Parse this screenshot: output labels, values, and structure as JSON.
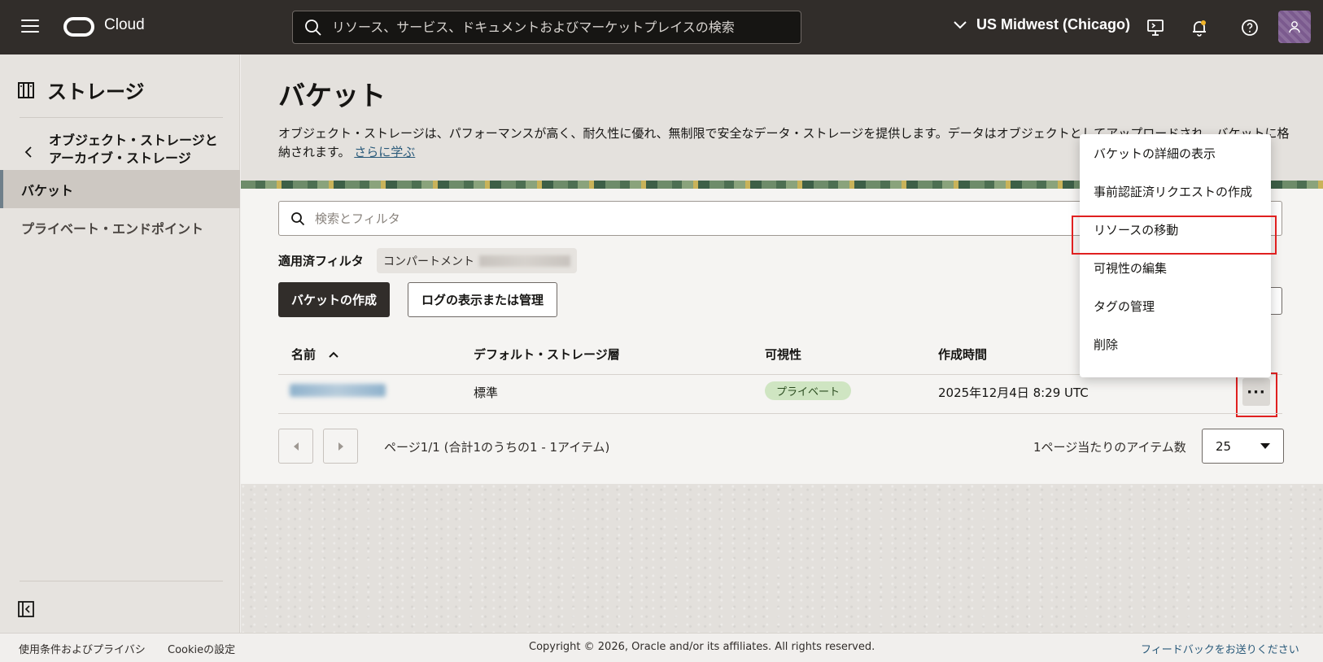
{
  "header": {
    "brand": "Cloud",
    "search_placeholder": "リソース、サービス、ドキュメントおよびマーケットプレイスの検索",
    "region": "US Midwest (Chicago)"
  },
  "sidebar": {
    "title": "ストレージ",
    "back_label": "オブジェクト・ストレージとアーカイブ・ストレージ",
    "items": [
      {
        "label": "バケット",
        "active": true
      },
      {
        "label": "プライベート・エンドポイント",
        "active": false
      }
    ]
  },
  "main": {
    "title": "バケット",
    "description": "オブジェクト・ストレージは、パフォーマンスが高く、耐久性に優れ、無制限で安全なデータ・ストレージを提供します。データはオブジェクトとしてアップロードされ、バケットに格納されます。",
    "learn_more": "さらに学ぶ",
    "filter_placeholder": "検索とフィルタ",
    "applied_filters_label": "適用済フィルタ",
    "compartment_chip": "コンパートメント",
    "create_button": "バケットの作成",
    "logs_button": "ログの表示または管理",
    "columns": [
      "名前",
      "デフォルト・ストレージ層",
      "可視性",
      "作成時間"
    ],
    "rows": [
      {
        "tier": "標準",
        "visibility": "プライベート",
        "created": "2025年12月4日 8:29 UTC"
      }
    ],
    "pagination_info": "ページ1/1 (合計1のうちの1 - 1アイテム)",
    "per_page_label": "1ページ当たりのアイテム数",
    "per_page_value": "25"
  },
  "context_menu": {
    "items": [
      "バケットの詳細の表示",
      "事前認証済リクエストの作成",
      "リソースの移動",
      "可視性の編集",
      "タグの管理",
      "削除"
    ]
  },
  "footer": {
    "terms": "使用条件およびプライバシ",
    "cookie": "Cookieの設定",
    "copyright": "Copyright © 2026, Oracle and/or its affiliates. All rights reserved.",
    "feedback": "フィードバックをお送りください"
  },
  "colors": {
    "topbar": "#312d2a",
    "highlight": "#e02020",
    "badge_bg": "#cfe5c2"
  }
}
